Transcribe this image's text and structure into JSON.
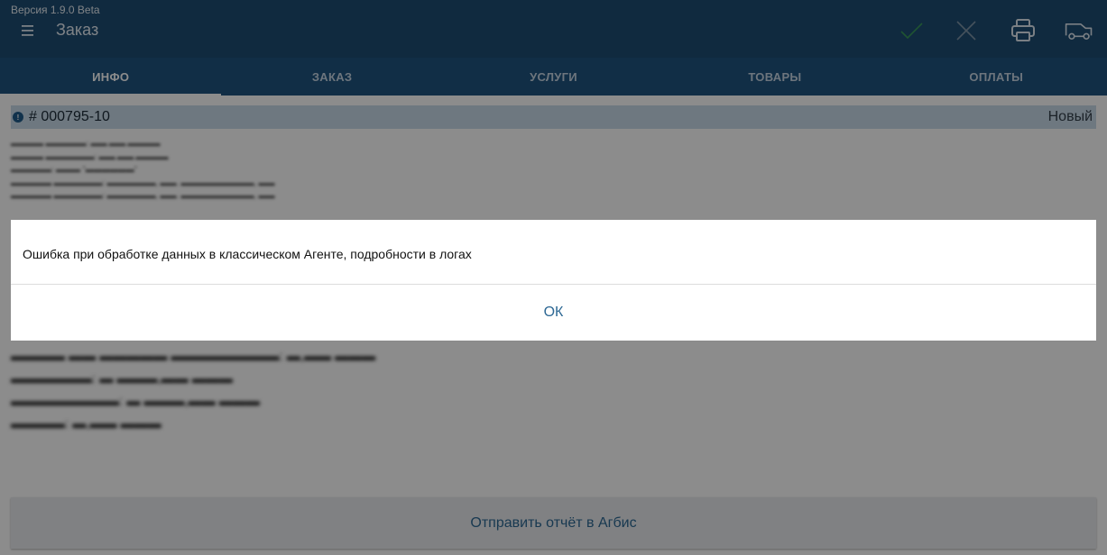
{
  "header": {
    "version": "Версия 1.9.0 Beta",
    "title": "Заказ",
    "icons": {
      "menu": "menu-icon",
      "confirm": "check-icon",
      "cancel": "close-icon",
      "print": "printer-icon",
      "delivery": "car-icon"
    }
  },
  "tabs": [
    {
      "label": "ИНФО",
      "active": true
    },
    {
      "label": "ЗАКАЗ",
      "active": false
    },
    {
      "label": "УСЛУГИ",
      "active": false
    },
    {
      "label": "ТОВАРЫ",
      "active": false
    },
    {
      "label": "ОПЛАТЫ",
      "active": false
    }
  ],
  "order": {
    "info_glyph": "!",
    "number": "# 000795-10",
    "status": "Новый"
  },
  "dialog": {
    "message": "Ошибка при обработке данных в классическом Агенте, подробности в логах",
    "ok_label": "ОК"
  },
  "footer": {
    "send_report_label": "Отправить отчёт в Агбис"
  },
  "colors": {
    "header_bg": "#1e4d74",
    "tabs_bg": "#1f5580",
    "order_bar_bg": "#c9dbe9",
    "accent_text": "#2d6894",
    "confirm_icon": "#3a9a5c",
    "cancel_icon": "#7e95a8"
  }
}
